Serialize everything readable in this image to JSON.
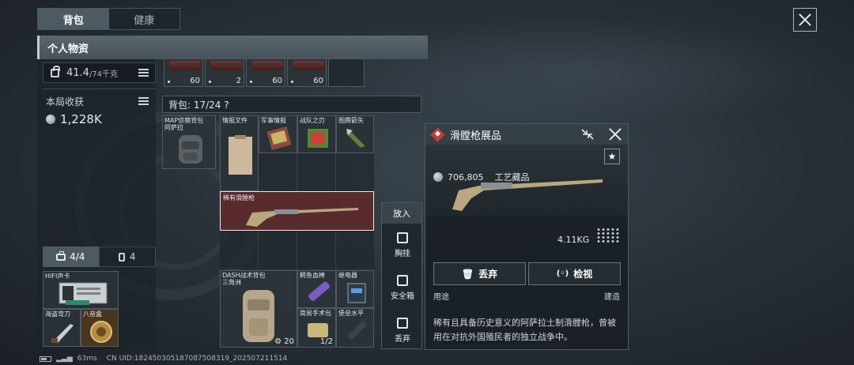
{
  "tabs": [
    {
      "label": "背包",
      "active": true
    },
    {
      "label": "健康",
      "active": false
    }
  ],
  "personal": {
    "title": "个人物资",
    "weight_value": "41.4",
    "weight_max": "/74千克",
    "harvest_title": "本局收获",
    "harvest_value": "1,228K"
  },
  "bottom_tabs": [
    {
      "label": "4/4",
      "icon": "case-icon"
    },
    {
      "label": "4",
      "icon": "bottle-icon"
    }
  ],
  "top_row_counts": [
    "60",
    "2",
    "60",
    "60"
  ],
  "bag": {
    "label": "背包: 17/24 ?"
  },
  "items": {
    "map_bag": "MAP侦察背包\n阿萨拉",
    "intel_doc": "情报文件",
    "military_intel": "军事情报",
    "war_blade": "战队之刃",
    "arrow": "图腾箭矢",
    "rare_musket": "稀有滑膛枪",
    "dash_bag": "DASH战术背包\n三角洲",
    "dash_count": "20",
    "fish_stick": "鳄鱼血棒",
    "battery": "继电器",
    "surgery_kit": "简易手术包",
    "surgery_count": "1/2",
    "fort_level": "堡垒水平",
    "hifi": "HIFI声卡",
    "pirate_blade": "海盗弯刀",
    "octagon": "八音盒"
  },
  "context_menu": {
    "header": "放入",
    "items": [
      {
        "label": "胸挂",
        "icon": "chest-rig-icon"
      },
      {
        "label": "安全箱",
        "icon": "safe-box-icon"
      },
      {
        "label": "丢弃",
        "icon": "trash-icon"
      }
    ]
  },
  "detail": {
    "title": "滑膛枪展品",
    "price": "706,805",
    "category": "工艺藏品",
    "weight": "4.11KG",
    "discard_label": "丢弃",
    "inspect_label": "检视",
    "usage_label": "用途",
    "build_label": "建造",
    "description": "稀有且具备历史意义的阿萨拉土制滑膛枪，曾被用在对抗外国殖民者的独立战争中。"
  },
  "status_bar": {
    "latency": "63ms",
    "uid": "CN UID:1824503051870875083​19_202507211514"
  },
  "colors": {
    "accent_red": "#c43a3a",
    "highlight_bg": "#5a2b2d",
    "tab_active": "#4d5a61"
  }
}
